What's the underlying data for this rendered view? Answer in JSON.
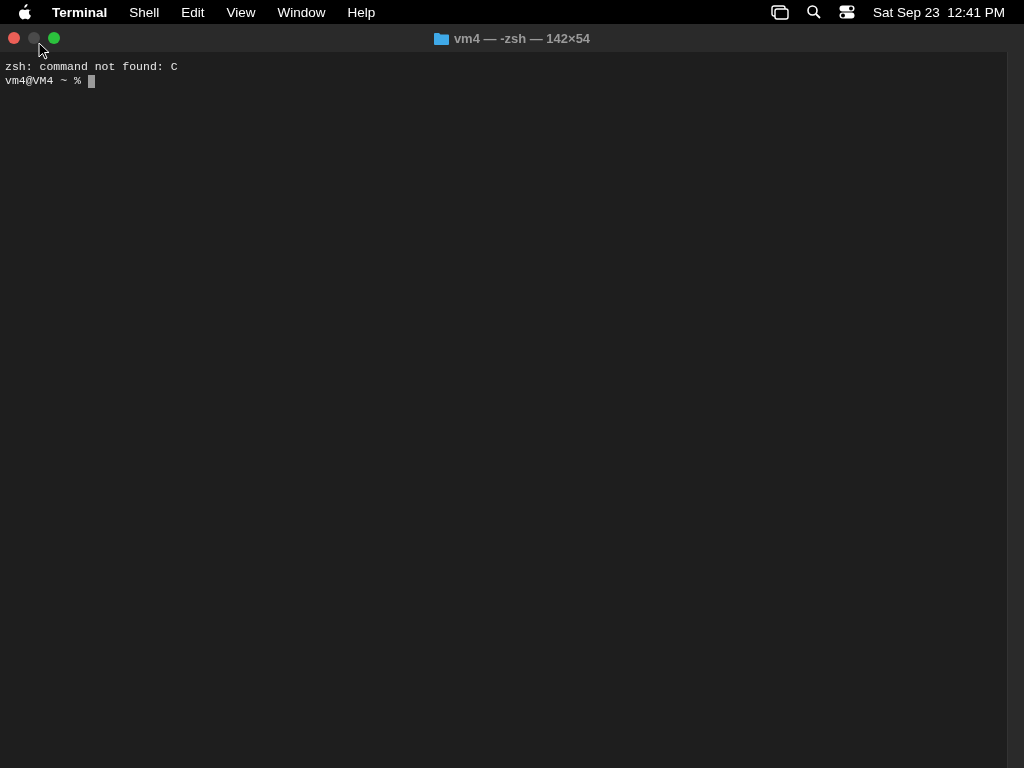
{
  "menu_bar": {
    "app_name": "Terminal",
    "items": [
      "Shell",
      "Edit",
      "View",
      "Window",
      "Help"
    ],
    "clock": "Sat Sep 23  12:41 PM"
  },
  "window": {
    "title": "vm4 — -zsh — 142×54"
  },
  "terminal": {
    "lines": [
      {
        "kind": "output",
        "text": "zsh: command not found: C"
      },
      {
        "kind": "prompt",
        "text": "vm4@VM4 ~ % "
      }
    ]
  }
}
